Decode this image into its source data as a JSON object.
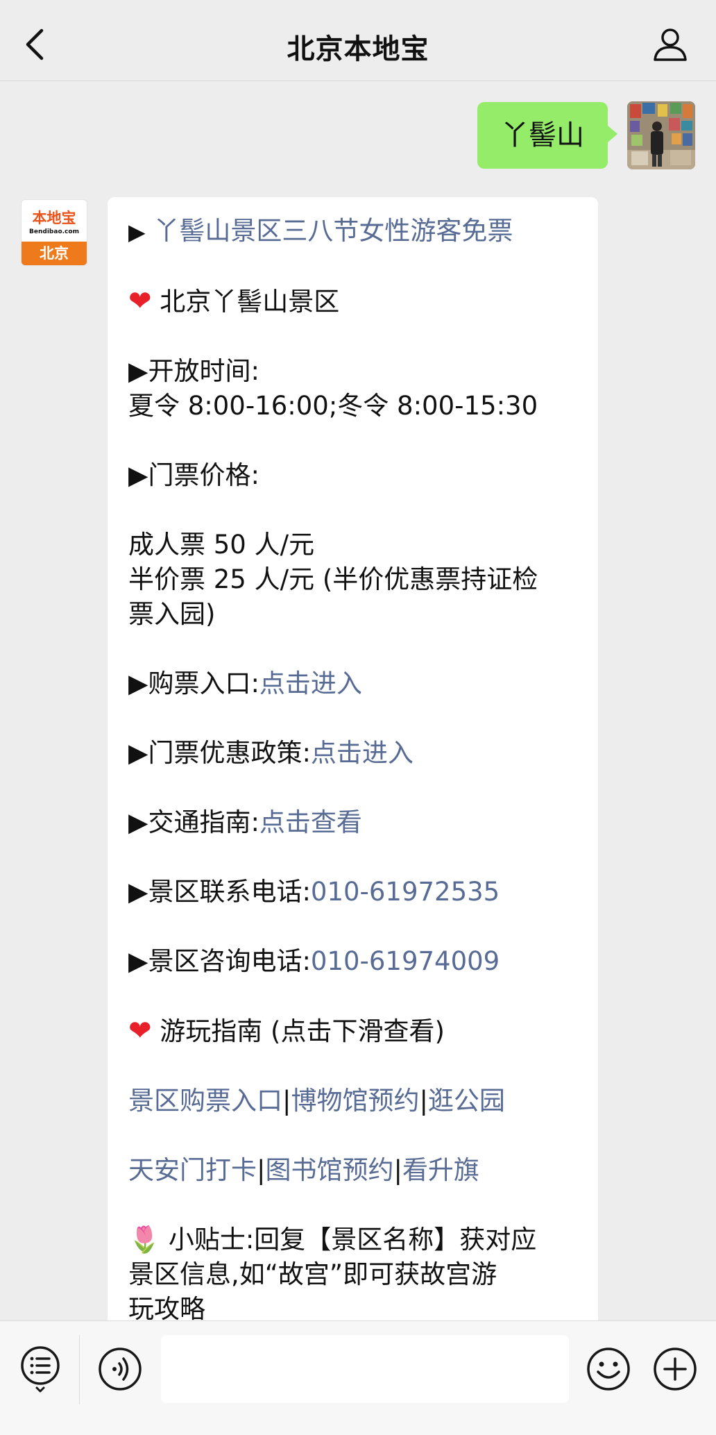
{
  "header": {
    "title": "北京本地宝",
    "back_icon": "back-chevron-icon",
    "profile_icon": "user-profile-icon"
  },
  "sent_message": {
    "text": "丫髻山"
  },
  "bot": {
    "avatar_logo_text": "本地宝",
    "avatar_logo_domain": "Bendibao.com",
    "avatar_logo_city": "北京"
  },
  "reply": {
    "headline_marker": "▶",
    "headline_link": "丫髻山景区三八节女性游客免票",
    "scenic_heading": "北京丫髻山景区",
    "open_time_label": "▶开放时间:",
    "open_time_value": "夏令 8:00-16:00;冬令 8:00-15:30",
    "ticket_price_label": "▶门票价格:",
    "ticket_adult": "成人票 50 人/元",
    "ticket_half_line1": "半价票 25 人/元 (半价优惠票持证检",
    "ticket_half_line2": "票入园)",
    "purchase_label": "▶购票入口:",
    "purchase_link": "点击进入",
    "discount_label": "▶门票优惠政策:",
    "discount_link": "点击进入",
    "traffic_label": "▶交通指南:",
    "traffic_link": "点击查看",
    "contact_phone_label": "▶景区联系电话:",
    "contact_phone": "010-61972535",
    "consult_phone_label": "▶景区咨询电话:",
    "consult_phone": "010-61974009",
    "guide_heading": "游玩指南 (点击下滑查看)",
    "quick_links_row1": [
      "景区购票入口",
      "博物馆预约",
      "逛公园"
    ],
    "quick_links_row2": [
      "天安门打卡",
      "图书馆预约",
      "看升旗"
    ],
    "separator": "|",
    "tip_line1": "🌷 小贴士:回复【景区名称】获对应",
    "tip_line2": "景区信息,如“故宫”即可获故宫游",
    "tip_line3": "玩攻略"
  },
  "input_bar": {
    "menu_icon": "menu-list-icon",
    "voice_icon": "voice-icon",
    "input_value": "",
    "emoji_icon": "emoji-icon",
    "plus_icon": "plus-icon"
  },
  "colors": {
    "background": "#ededed",
    "sent_bubble": "#95ec69",
    "link": "#576b95",
    "heart": "#e8202a",
    "brand_orange": "#ee7a1b"
  }
}
